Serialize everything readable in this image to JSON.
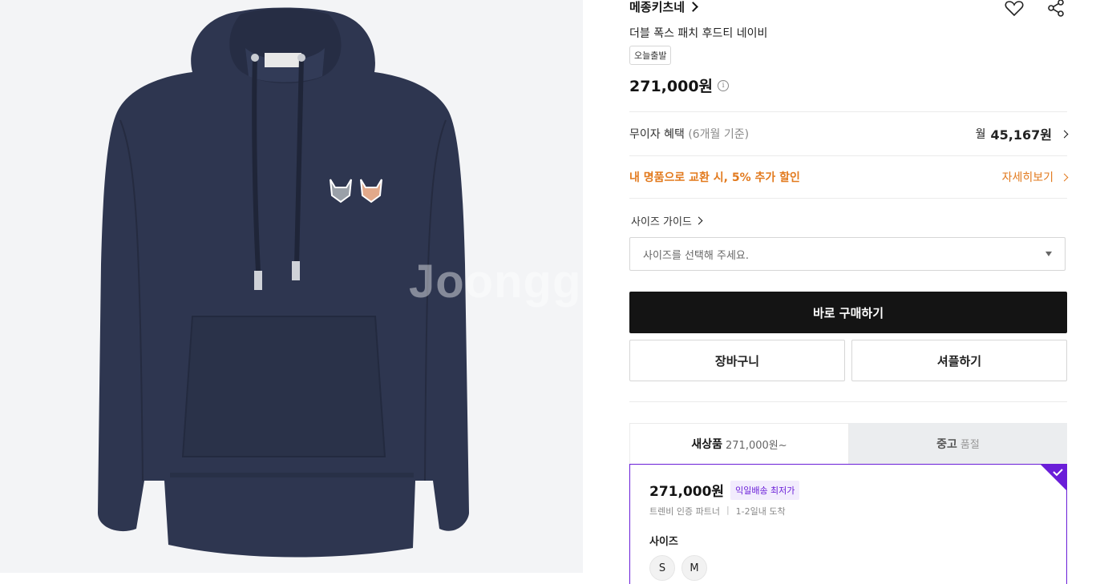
{
  "image": {
    "watermark": "Joonggonara",
    "colors": {
      "background": "#f3f4f6",
      "hoodie": "#2e3650",
      "hoodie_shadow": "#262d44"
    }
  },
  "product": {
    "brand": "메종키츠네",
    "name": "더블 폭스 패치 후드티 네이비",
    "badge": "오늘출발",
    "price": "271,000원"
  },
  "icons": {
    "wishlist": "heart-icon",
    "share": "share-icon",
    "price_info": "info-icon"
  },
  "installment": {
    "label": "무이자 혜택",
    "note": "(6개월 기준)",
    "prefix": "월",
    "amount": "45,167원"
  },
  "promo": {
    "text": "내 명품으로 교환 시, 5% 추가 할인",
    "link": "자세히보기",
    "color": "#e27a1e"
  },
  "size_guide": "사이즈 가이드",
  "size_select": {
    "placeholder": "사이즈를 선택해 주세요."
  },
  "buttons": {
    "buy_now": "바로 구매하기",
    "cart": "장바구니",
    "share": "셔플하기"
  },
  "tabs": [
    {
      "label": "새상품",
      "sub": "271,000원~",
      "active": true
    },
    {
      "label": "중고",
      "sub": "품절",
      "active": false
    }
  ],
  "offer": {
    "price": "271,000원",
    "tag": "익일배송 최저가",
    "seller": "트렌비 인증 파트너",
    "delivery": "1-2일내 도착",
    "size_label": "사이즈",
    "sizes": [
      "S",
      "M"
    ],
    "accent": "#6a1ed8"
  }
}
